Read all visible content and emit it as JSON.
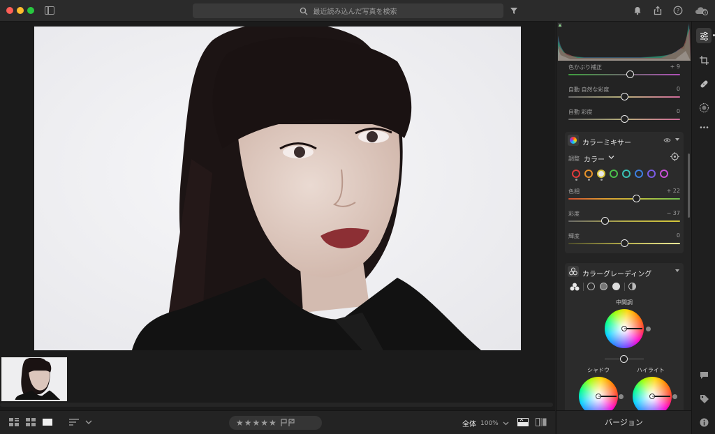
{
  "window": {
    "search_placeholder": "最近読み込んだ写真を検索"
  },
  "adjustments": [
    {
      "label": "色かぶり補正",
      "value": "+ 9",
      "pos": 0.55
    },
    {
      "label": "自動 自然な彩度",
      "value": "0",
      "pos": 0.5
    },
    {
      "label": "自動 彩度",
      "value": "0",
      "pos": 0.5
    }
  ],
  "color_mixer": {
    "title": "カラーミキサー",
    "adjust_label": "調整",
    "adjust_value": "カラー",
    "hue_label": "色相",
    "hue_value": "+ 22",
    "hue_pos": 0.61,
    "saturation_label": "彩度",
    "saturation_value": "− 37",
    "saturation_pos": 0.33,
    "luminance_label": "輝度",
    "luminance_value": "0",
    "luminance_pos": 0.5,
    "swatch_colors": [
      "#e03a3a",
      "#e8932a",
      "#d8c53a",
      "#4cc04c",
      "#39c2b5",
      "#3d7fe0",
      "#7a5ce6",
      "#c94fd6"
    ]
  },
  "color_grading": {
    "title": "カラーグレーディング",
    "midtones_label": "中間調",
    "shadows_label": "シャドウ",
    "highlights_label": "ハイライト"
  },
  "bottom": {
    "stars": "★★★★★",
    "zoom_label": "全体",
    "zoom_pct": "100%"
  },
  "version_label": "バージョン"
}
